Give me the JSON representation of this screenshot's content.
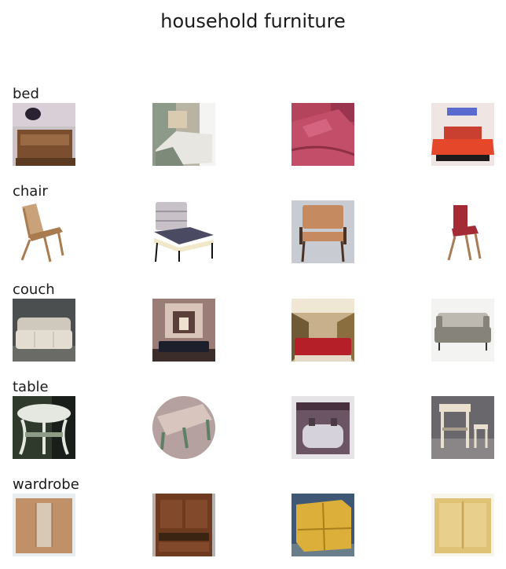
{
  "figure": {
    "title": "household furniture",
    "rows": [
      {
        "label": "bed",
        "images": [
          {
            "subject": "bed-with-wooden-frame",
            "background": "#c9c2c6",
            "object": "#7a4e2e",
            "accent": "#d9cfd6"
          },
          {
            "subject": "bed-in-room",
            "background": "#b9b3a3",
            "object": "#e8e6e0",
            "accent": "#7d8a7a"
          },
          {
            "subject": "bed-with-pink-cover",
            "background": "#b4445c",
            "object": "#c24e6a",
            "accent": "#8e2f45"
          },
          {
            "subject": "bed-with-red-cover",
            "background": "#efe6e3",
            "object": "#e5472b",
            "accent": "#1d1b1b"
          }
        ]
      },
      {
        "label": "chair",
        "images": [
          {
            "subject": "wooden-folding-chair",
            "background": "#ffffff",
            "object": "#a97b4e",
            "accent": "#c9a27a"
          },
          {
            "subject": "upholstered-striped-chair",
            "background": "#ffffff",
            "object": "#4a4a63",
            "accent": "#c8c2c8"
          },
          {
            "subject": "tan-leather-armchair",
            "background": "#c9cbd3",
            "object": "#c58a60",
            "accent": "#4a3326"
          },
          {
            "subject": "red-cushion-folding-chair",
            "background": "#ffffff",
            "object": "#a42b36",
            "accent": "#a87c55"
          }
        ]
      },
      {
        "label": "couch",
        "images": [
          {
            "subject": "beige-sofa",
            "background": "#4b4f50",
            "object": "#cfc8bd",
            "accent": "#e3ddd1"
          },
          {
            "subject": "black-bench-with-fireplace",
            "background": "#9a7d76",
            "object": "#1e1f2d",
            "accent": "#d8c4b8"
          },
          {
            "subject": "red-sofa-in-room",
            "background": "#c7b08b",
            "object": "#b51f28",
            "accent": "#6f5a35"
          },
          {
            "subject": "gray-armchair",
            "background": "#f3f3f2",
            "object": "#86837a",
            "accent": "#bdb9b1"
          }
        ]
      },
      {
        "label": "table",
        "images": [
          {
            "subject": "white-ornate-side-table",
            "background": "#2f3a2c",
            "object": "#e5e8e0",
            "accent": "#8e9b86"
          },
          {
            "subject": "round-table-with-green-legs",
            "background": "#b4a1a0",
            "object": "#5d8064",
            "accent": "#d8c5bd"
          },
          {
            "subject": "table-with-white-cloth",
            "background": "#e6e3e7",
            "object": "#d6d2db",
            "accent": "#6b5564"
          },
          {
            "subject": "white-bar-table-and-stool",
            "background": "#6a676c",
            "object": "#e8dfcf",
            "accent": "#a89d8d"
          }
        ]
      },
      {
        "label": "wardrobe",
        "images": [
          {
            "subject": "wooden-wardrobe-with-mirror",
            "background": "#e8edf0",
            "object": "#c09068",
            "accent": "#d8c9b7"
          },
          {
            "subject": "dark-wood-armoire",
            "background": "#b7b1ad",
            "object": "#6e3b20",
            "accent": "#3b2412"
          },
          {
            "subject": "yellow-wood-cabinet",
            "background": "#3d5774",
            "object": "#dcae3a",
            "accent": "#a97e1d"
          },
          {
            "subject": "pale-yellow-cabinet",
            "background": "#f8f5ec",
            "object": "#dfc276",
            "accent": "#c8a45a"
          }
        ]
      }
    ]
  }
}
